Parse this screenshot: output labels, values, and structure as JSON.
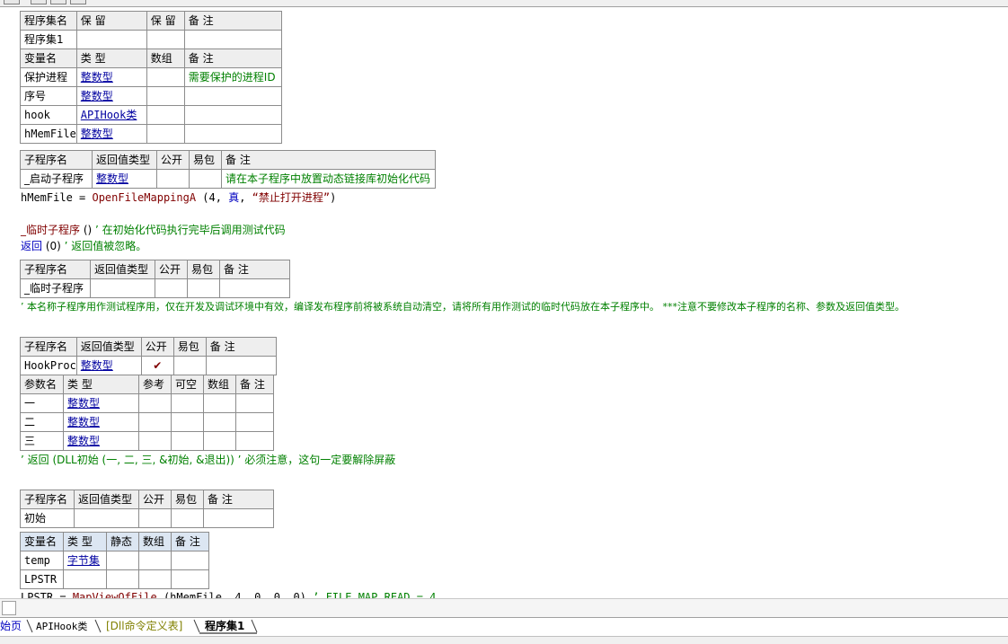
{
  "assembly": {
    "header": [
      "程序集名",
      "保 留",
      "保 留",
      "备 注"
    ],
    "row": [
      "程序集1",
      "",
      "",
      ""
    ],
    "var_header": [
      "变量名",
      "类 型",
      "数组",
      "备 注"
    ],
    "vars": [
      [
        "保护进程",
        "整数型",
        "",
        "需要保护的进程ID"
      ],
      [
        "序号",
        "整数型",
        "",
        ""
      ],
      [
        "hook",
        "APIHook类",
        "",
        ""
      ],
      [
        "hMemFile",
        "整数型",
        "",
        ""
      ]
    ]
  },
  "sub_startup": {
    "header": [
      "子程序名",
      "返回值类型",
      "公开",
      "易包",
      "备 注"
    ],
    "row": [
      "_启动子程序",
      "整数型",
      "",
      "",
      "请在本子程序中放置动态链接库初始化代码"
    ],
    "code": {
      "var": "hMemFile",
      "op": " = ",
      "fn": "OpenFileMappingA",
      "args_open": " (4, ",
      "kw": "真",
      "sep": ", ",
      "str": "“禁止打开进程”",
      "close": ")"
    }
  },
  "temp_call": {
    "name": "_临时子程序",
    "args": " ()  ",
    "comment": "’ 在初始化代码执行完毕后调用测试代码"
  },
  "return_line": {
    "kw": "返回",
    "args": " (0)  ",
    "comment": "’ 返回值被忽略。"
  },
  "sub_temp": {
    "header": [
      "子程序名",
      "返回值类型",
      "公开",
      "易包",
      "备 注"
    ],
    "row": [
      "_临时子程序",
      "",
      "",
      "",
      ""
    ],
    "comment": "’ 本名称子程序用作测试程序用，仅在开发及调试环境中有效，编译发布程序前将被系统自动清空，请将所有用作测试的临时代码放在本子程序中。 ***注意不要修改本子程序的名称、参数及返回值类型。"
  },
  "sub_hookproc": {
    "header": [
      "子程序名",
      "返回值类型",
      "公开",
      "易包",
      "备 注"
    ],
    "row": [
      "HookProc",
      "整数型",
      "✔",
      "",
      ""
    ],
    "param_header": [
      "参数名",
      "类 型",
      "参考",
      "可空",
      "数组",
      "备 注"
    ],
    "params": [
      [
        "一",
        "整数型",
        "",
        "",
        "",
        ""
      ],
      [
        "二",
        "整数型",
        "",
        "",
        "",
        ""
      ],
      [
        "三",
        "整数型",
        "",
        "",
        "",
        ""
      ]
    ],
    "comment": "’ 返回 (DLL初始 (一, 二, 三, &初始, &退出))  ’ 必须注意，这句一定要解除屏蔽"
  },
  "sub_init": {
    "header": [
      "子程序名",
      "返回值类型",
      "公开",
      "易包",
      "备 注"
    ],
    "row": [
      "初始",
      "",
      "",
      "",
      ""
    ],
    "local_header": [
      "变量名",
      "类 型",
      "静态",
      "数组",
      "备 注"
    ],
    "locals": [
      [
        "temp",
        "字节集",
        "",
        "",
        ""
      ],
      [
        "LPSTR",
        "",
        "",
        "",
        ""
      ]
    ],
    "code": {
      "var": "LPSTR",
      "op": " = ",
      "fn": "MapViewOfFile",
      "args": " (hMemFile, 4, 0, 0, 0)  ",
      "comment": "’ FILE_MAP_READ = 4"
    }
  },
  "tabs": [
    "始页",
    "APIHook类",
    "[Dll命令定义表]",
    "程序集1"
  ]
}
